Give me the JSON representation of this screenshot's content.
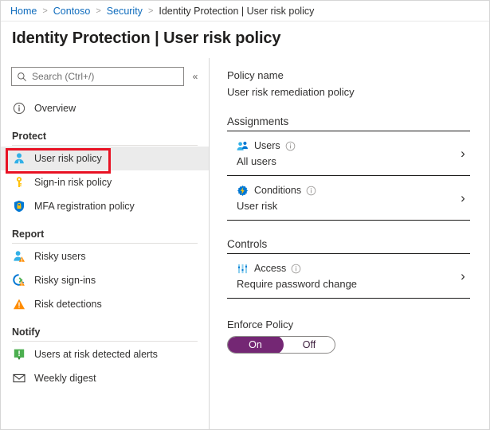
{
  "breadcrumb": {
    "items": [
      {
        "label": "Home",
        "link": true
      },
      {
        "label": "Contoso",
        "link": true
      },
      {
        "label": "Security",
        "link": true
      },
      {
        "label": "Identity Protection | User risk policy",
        "link": false
      }
    ],
    "separator": ">"
  },
  "page": {
    "title": "Identity Protection | User risk policy"
  },
  "sidebar": {
    "search": {
      "placeholder": "Search (Ctrl+/)",
      "value": "",
      "icon": "search-icon"
    },
    "collapse": {
      "label": "«",
      "icon": "chevron-double-left-icon"
    },
    "overview": {
      "label": "Overview",
      "icon": "info-circle-icon"
    },
    "sections": [
      {
        "title": "Protect",
        "items": [
          {
            "label": "User risk policy",
            "icon": "user-icon",
            "selected": true,
            "highlighted": true
          },
          {
            "label": "Sign-in risk policy",
            "icon": "key-icon",
            "selected": false,
            "highlighted": false
          },
          {
            "label": "MFA registration policy",
            "icon": "shield-lock-icon",
            "selected": false,
            "highlighted": false
          }
        ]
      },
      {
        "title": "Report",
        "items": [
          {
            "label": "Risky users",
            "icon": "risky-user-icon",
            "selected": false,
            "highlighted": false
          },
          {
            "label": "Risky sign-ins",
            "icon": "risky-signin-icon",
            "selected": false,
            "highlighted": false
          },
          {
            "label": "Risk detections",
            "icon": "warning-triangle-icon",
            "selected": false,
            "highlighted": false
          }
        ]
      },
      {
        "title": "Notify",
        "items": [
          {
            "label": "Users at risk detected alerts",
            "icon": "alert-square-icon",
            "selected": false,
            "highlighted": false
          },
          {
            "label": "Weekly digest",
            "icon": "envelope-icon",
            "selected": false,
            "highlighted": false
          }
        ]
      }
    ]
  },
  "main": {
    "policy_name_label": "Policy name",
    "policy_name_value": "User risk remediation policy",
    "assignments": {
      "heading": "Assignments",
      "rows": [
        {
          "title": "Users",
          "value": "All users",
          "icon": "users-icon",
          "info_icon": "info-icon",
          "chevron": "›"
        },
        {
          "title": "Conditions",
          "value": "User risk",
          "icon": "conditions-gear-icon",
          "info_icon": "info-icon",
          "chevron": "›"
        }
      ]
    },
    "controls": {
      "heading": "Controls",
      "rows": [
        {
          "title": "Access",
          "value": "Require password change",
          "icon": "access-sliders-icon",
          "info_icon": "info-icon",
          "chevron": "›"
        }
      ]
    },
    "enforce": {
      "label": "Enforce Policy",
      "on_label": "On",
      "off_label": "Off",
      "selected": "On"
    }
  },
  "colors": {
    "link": "#0f6cbd",
    "accent_purple": "#742774",
    "highlight_red": "#e81123",
    "selected_bg": "#ebebeb",
    "icon_blue": "#0078d4",
    "icon_orange": "#ff8c00",
    "icon_green": "#107c10",
    "icon_yellow": "#ffb900"
  }
}
